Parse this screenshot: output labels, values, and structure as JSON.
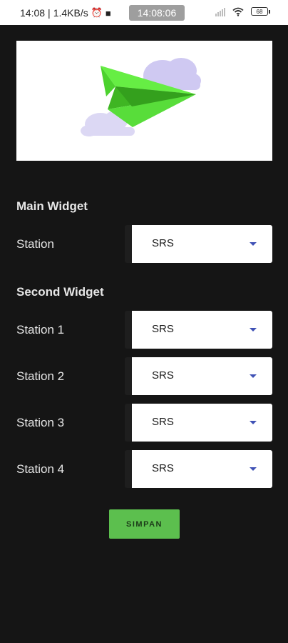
{
  "status_bar": {
    "time": "14:08",
    "network_speed": "1.4KB/s",
    "clock_pill": "14:08:06",
    "battery": "68"
  },
  "main_widget": {
    "title": "Main Widget",
    "station_label": "Station",
    "station_value": "SRS"
  },
  "second_widget": {
    "title": "Second Widget",
    "rows": [
      {
        "label": "Station 1",
        "value": "SRS"
      },
      {
        "label": "Station 2",
        "value": "SRS"
      },
      {
        "label": "Station 3",
        "value": "SRS"
      },
      {
        "label": "Station 4",
        "value": "SRS"
      }
    ]
  },
  "save_button": "SIMPAN",
  "colors": {
    "background": "#151515",
    "accent_green": "#5cbf4e",
    "dropdown_arrow": "#3f51b5"
  }
}
